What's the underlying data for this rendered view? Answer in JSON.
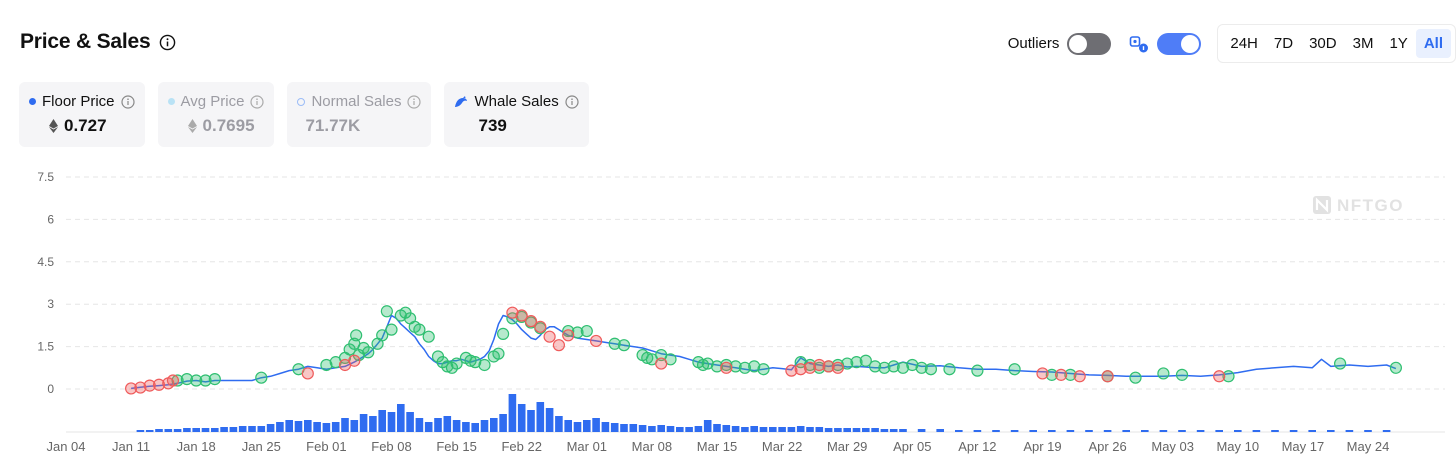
{
  "header": {
    "title": "Price & Sales"
  },
  "controls": {
    "outliers_label": "Outliers",
    "outliers_on": false,
    "mode_toggle_on": true,
    "ranges": [
      "24H",
      "7D",
      "30D",
      "3M",
      "1Y",
      "All"
    ],
    "active_range": "All"
  },
  "legend_cards": [
    {
      "label": "Floor Price",
      "value": "0.727",
      "marker": "dot",
      "color": "#2f6cf0",
      "eth_icon": true,
      "dimmed": false
    },
    {
      "label": "Avg Price",
      "value": "0.7695",
      "marker": "dot",
      "color": "#b9e2f5",
      "eth_icon": true,
      "dimmed": true
    },
    {
      "label": "Normal Sales",
      "value": "71.77K",
      "marker": "ring",
      "color": "#9bbcf7",
      "eth_icon": false,
      "dimmed": true
    },
    {
      "label": "Whale Sales",
      "value": "739",
      "marker": "whale-icon",
      "color": "#2f6cf0",
      "eth_icon": false,
      "dimmed": false
    }
  ],
  "watermark": "NFTGO",
  "colors": {
    "floor_line": "#2f6cf0",
    "volume_bar": "#2f6cf0",
    "sale_green": "#2fbf71",
    "sale_red": "#ef5b5b",
    "grid": "#e6e6e6",
    "axis_text": "#666666"
  },
  "chart_data": {
    "type": "line",
    "ylim": [
      0,
      7.5
    ],
    "yticks": [
      "7.5",
      "6",
      "4.5",
      "3",
      "1.5",
      "0"
    ],
    "x_tick_labels": [
      "Jan 04",
      "Jan 11",
      "Jan 18",
      "Jan 25",
      "Feb 01",
      "Feb 08",
      "Feb 15",
      "Feb 22",
      "Mar 01",
      "Mar 08",
      "Mar 15",
      "Mar 22",
      "Mar 29",
      "Apr 05",
      "Apr 12",
      "Apr 19",
      "Apr 26",
      "May 03",
      "May 10",
      "May 17",
      "May 24"
    ],
    "x_range_days": [
      0,
      144
    ],
    "grid": true,
    "series": [
      {
        "name": "Floor Price",
        "x_day": [
          7,
          8,
          9,
          10,
          11,
          12,
          13,
          14,
          15,
          16,
          17,
          18,
          19,
          20,
          21,
          22,
          23,
          24,
          25,
          26,
          27,
          28,
          29,
          30,
          31,
          31.5,
          32,
          32.5,
          33,
          33.5,
          34,
          34.5,
          35,
          35.5,
          36,
          36.5,
          37,
          37.5,
          38,
          38.5,
          39,
          39.5,
          40,
          40.5,
          41,
          41.5,
          42,
          42.5,
          43,
          43.5,
          44,
          44.5,
          45,
          45.5,
          46,
          46.5,
          47,
          47.5,
          48,
          48.5,
          49,
          49.5,
          50,
          50.5,
          51,
          51.5,
          52,
          52.5,
          53,
          53.5,
          54,
          54.5,
          55,
          56,
          57,
          58,
          59,
          60,
          61,
          62,
          63,
          64,
          65,
          66,
          67,
          68,
          69,
          70,
          71,
          72,
          73,
          74,
          75,
          76,
          77,
          78,
          79,
          80,
          81,
          82,
          83,
          84,
          85,
          86,
          87,
          88,
          89,
          90,
          92,
          94,
          96,
          98,
          100,
          102,
          104,
          106,
          108,
          110,
          112,
          114,
          116,
          118,
          120,
          122,
          124,
          126,
          128,
          130,
          132,
          134,
          135,
          136,
          138,
          140,
          142,
          143
        ],
        "y": [
          0.02,
          0.06,
          0.1,
          0.12,
          0.15,
          0.2,
          0.28,
          0.3,
          0.25,
          0.3,
          0.3,
          0.3,
          0.3,
          0.3,
          0.4,
          0.45,
          0.55,
          0.65,
          0.7,
          0.8,
          0.75,
          0.7,
          0.75,
          0.8,
          0.95,
          1.05,
          1.15,
          1.25,
          1.4,
          1.6,
          1.8,
          2.2,
          2.6,
          2.5,
          2.3,
          2.15,
          2.0,
          1.85,
          1.6,
          1.4,
          1.15,
          1.0,
          0.9,
          0.9,
          0.95,
          1.0,
          1.0,
          1.05,
          1.0,
          0.95,
          1.0,
          1.05,
          1.15,
          1.35,
          1.75,
          2.3,
          2.6,
          2.55,
          2.45,
          2.3,
          2.1,
          1.95,
          1.8,
          1.75,
          1.9,
          2.1,
          2.2,
          2.2,
          2.1,
          2.0,
          1.9,
          1.85,
          1.8,
          1.75,
          1.7,
          1.65,
          1.6,
          1.55,
          1.5,
          1.45,
          1.35,
          1.25,
          1.2,
          1.15,
          1.05,
          0.95,
          0.9,
          0.85,
          0.8,
          0.75,
          0.7,
          0.65,
          0.7,
          0.75,
          0.72,
          0.68,
          1.1,
          0.9,
          0.85,
          0.8,
          0.85,
          0.78,
          0.8,
          0.78,
          0.75,
          0.75,
          0.85,
          0.95,
          0.8,
          0.82,
          0.75,
          0.7,
          0.7,
          0.65,
          0.62,
          0.6,
          0.55,
          0.5,
          0.48,
          0.45,
          0.45,
          0.45,
          0.48,
          0.45,
          0.5,
          0.58,
          0.7,
          0.75,
          0.8,
          0.75,
          1.05,
          0.8,
          0.85,
          0.8,
          0.85,
          0.72
        ]
      },
      {
        "name": "Normal Sales",
        "points": [
          [
            12,
            0.3,
            "g"
          ],
          [
            13,
            0.35,
            "g"
          ],
          [
            14,
            0.3,
            "g"
          ],
          [
            15,
            0.3,
            "g"
          ],
          [
            16,
            0.35,
            "g"
          ],
          [
            21,
            0.4,
            "g"
          ],
          [
            25,
            0.7,
            "g"
          ],
          [
            28,
            0.85,
            "g"
          ],
          [
            29,
            0.95,
            "g"
          ],
          [
            30,
            1.1,
            "g"
          ],
          [
            30.5,
            1.4,
            "g"
          ],
          [
            31,
            1.6,
            "g"
          ],
          [
            31.2,
            1.9,
            "g"
          ],
          [
            31.5,
            1.2,
            "g"
          ],
          [
            32,
            1.45,
            "g"
          ],
          [
            32.5,
            1.3,
            "g"
          ],
          [
            33.5,
            1.6,
            "g"
          ],
          [
            34,
            1.9,
            "g"
          ],
          [
            34.5,
            2.75,
            "g"
          ],
          [
            35,
            2.1,
            "g"
          ],
          [
            36,
            2.6,
            "g"
          ],
          [
            36.5,
            2.7,
            "g"
          ],
          [
            37,
            2.5,
            "g"
          ],
          [
            37.5,
            2.2,
            "g"
          ],
          [
            38,
            2.1,
            "g"
          ],
          [
            39,
            1.85,
            "g"
          ],
          [
            40,
            1.15,
            "g"
          ],
          [
            40.5,
            0.95,
            "g"
          ],
          [
            41,
            0.8,
            "g"
          ],
          [
            41.5,
            0.75,
            "g"
          ],
          [
            42,
            0.9,
            "g"
          ],
          [
            43,
            1.1,
            "g"
          ],
          [
            43.5,
            1.0,
            "g"
          ],
          [
            44,
            0.95,
            "g"
          ],
          [
            45,
            0.85,
            "g"
          ],
          [
            46,
            1.15,
            "g"
          ],
          [
            46.5,
            1.25,
            "g"
          ],
          [
            47,
            1.95,
            "g"
          ],
          [
            48,
            2.5,
            "g"
          ],
          [
            49,
            2.55,
            "g"
          ],
          [
            50,
            2.35,
            "g"
          ],
          [
            51,
            2.15,
            "g"
          ],
          [
            54,
            2.05,
            "g"
          ],
          [
            55,
            2.0,
            "g"
          ],
          [
            56,
            2.05,
            "g"
          ],
          [
            59,
            1.6,
            "g"
          ],
          [
            60,
            1.55,
            "g"
          ],
          [
            62,
            1.2,
            "g"
          ],
          [
            62.5,
            1.1,
            "g"
          ],
          [
            63,
            1.05,
            "g"
          ],
          [
            64,
            1.2,
            "g"
          ],
          [
            65,
            1.05,
            "g"
          ],
          [
            68,
            0.95,
            "g"
          ],
          [
            68.5,
            0.85,
            "g"
          ],
          [
            69,
            0.9,
            "g"
          ],
          [
            70,
            0.8,
            "g"
          ],
          [
            71,
            0.85,
            "g"
          ],
          [
            72,
            0.8,
            "g"
          ],
          [
            73,
            0.75,
            "g"
          ],
          [
            74,
            0.8,
            "g"
          ],
          [
            75,
            0.7,
            "g"
          ],
          [
            79,
            0.95,
            "g"
          ],
          [
            80,
            0.85,
            "g"
          ],
          [
            81,
            0.75,
            "g"
          ],
          [
            82,
            0.8,
            "g"
          ],
          [
            83,
            0.85,
            "g"
          ],
          [
            84,
            0.9,
            "g"
          ],
          [
            85,
            0.95,
            "g"
          ],
          [
            86,
            1.0,
            "g"
          ],
          [
            87,
            0.8,
            "g"
          ],
          [
            88,
            0.75,
            "g"
          ],
          [
            89,
            0.8,
            "g"
          ],
          [
            90,
            0.75,
            "g"
          ],
          [
            91,
            0.85,
            "g"
          ],
          [
            92,
            0.75,
            "g"
          ],
          [
            93,
            0.7,
            "g"
          ],
          [
            95,
            0.7,
            "g"
          ],
          [
            98,
            0.65,
            "g"
          ],
          [
            102,
            0.7,
            "g"
          ],
          [
            106,
            0.5,
            "g"
          ],
          [
            108,
            0.5,
            "g"
          ],
          [
            112,
            0.45,
            "g"
          ],
          [
            115,
            0.4,
            "g"
          ],
          [
            118,
            0.55,
            "g"
          ],
          [
            120,
            0.5,
            "g"
          ],
          [
            125,
            0.45,
            "g"
          ],
          [
            137,
            0.9,
            "g"
          ],
          [
            143,
            0.75,
            "g"
          ]
        ]
      },
      {
        "name": "Whale Sales",
        "points": [
          [
            7,
            0.02,
            "r"
          ],
          [
            8,
            0.05,
            "r"
          ],
          [
            9,
            0.12,
            "r"
          ],
          [
            10,
            0.15,
            "r"
          ],
          [
            11,
            0.2,
            "r"
          ],
          [
            11.5,
            0.3,
            "r"
          ],
          [
            26,
            0.55,
            "r"
          ],
          [
            30,
            0.85,
            "r"
          ],
          [
            31,
            1.0,
            "r"
          ],
          [
            48,
            2.7,
            "r"
          ],
          [
            49,
            2.6,
            "r"
          ],
          [
            50,
            2.4,
            "r"
          ],
          [
            51,
            2.2,
            "r"
          ],
          [
            52,
            1.85,
            "r"
          ],
          [
            53,
            1.55,
            "r"
          ],
          [
            54,
            1.9,
            "r"
          ],
          [
            57,
            1.7,
            "r"
          ],
          [
            64,
            0.9,
            "r"
          ],
          [
            71,
            0.75,
            "r"
          ],
          [
            78,
            0.65,
            "r"
          ],
          [
            79,
            0.7,
            "r"
          ],
          [
            80,
            0.75,
            "r"
          ],
          [
            81,
            0.85,
            "r"
          ],
          [
            82,
            0.8,
            "r"
          ],
          [
            83,
            0.75,
            "r"
          ],
          [
            105,
            0.55,
            "r"
          ],
          [
            107,
            0.5,
            "r"
          ],
          [
            109,
            0.45,
            "r"
          ],
          [
            112,
            0.45,
            "r"
          ],
          [
            124,
            0.45,
            "r"
          ]
        ]
      },
      {
        "name": "Volume",
        "x_day": [
          8,
          9,
          10,
          11,
          12,
          13,
          14,
          15,
          16,
          17,
          18,
          19,
          20,
          21,
          22,
          23,
          24,
          25,
          26,
          27,
          28,
          29,
          30,
          31,
          32,
          33,
          34,
          35,
          36,
          37,
          38,
          39,
          40,
          41,
          42,
          43,
          44,
          45,
          46,
          47,
          48,
          49,
          50,
          51,
          52,
          53,
          54,
          55,
          56,
          57,
          58,
          59,
          60,
          61,
          62,
          63,
          64,
          65,
          66,
          67,
          68,
          69,
          70,
          71,
          72,
          73,
          74,
          75,
          76,
          77,
          78,
          79,
          80,
          81,
          82,
          83,
          84,
          85,
          86,
          87,
          88,
          89,
          90,
          92,
          94,
          96,
          98,
          100,
          102,
          104,
          106,
          108,
          110,
          112,
          114,
          116,
          118,
          120,
          122,
          124,
          126,
          128,
          130,
          132,
          134,
          136,
          138,
          140,
          142
        ],
        "values": [
          2,
          2,
          3,
          3,
          3,
          4,
          4,
          4,
          4,
          5,
          5,
          6,
          6,
          6,
          8,
          10,
          12,
          11,
          12,
          10,
          9,
          10,
          14,
          12,
          18,
          16,
          22,
          20,
          28,
          20,
          14,
          10,
          14,
          16,
          12,
          10,
          9,
          12,
          14,
          18,
          38,
          28,
          22,
          30,
          24,
          16,
          12,
          10,
          12,
          14,
          10,
          9,
          8,
          8,
          7,
          6,
          7,
          6,
          5,
          5,
          6,
          12,
          8,
          7,
          6,
          5,
          6,
          5,
          5,
          5,
          5,
          6,
          5,
          5,
          4,
          4,
          4,
          4,
          4,
          4,
          3,
          3,
          3,
          3,
          3,
          2,
          2,
          2,
          2,
          2,
          2,
          2,
          2,
          2,
          2,
          2,
          2,
          2,
          2,
          2,
          2,
          2,
          2,
          2,
          2,
          2,
          2,
          2,
          2
        ]
      }
    ]
  }
}
